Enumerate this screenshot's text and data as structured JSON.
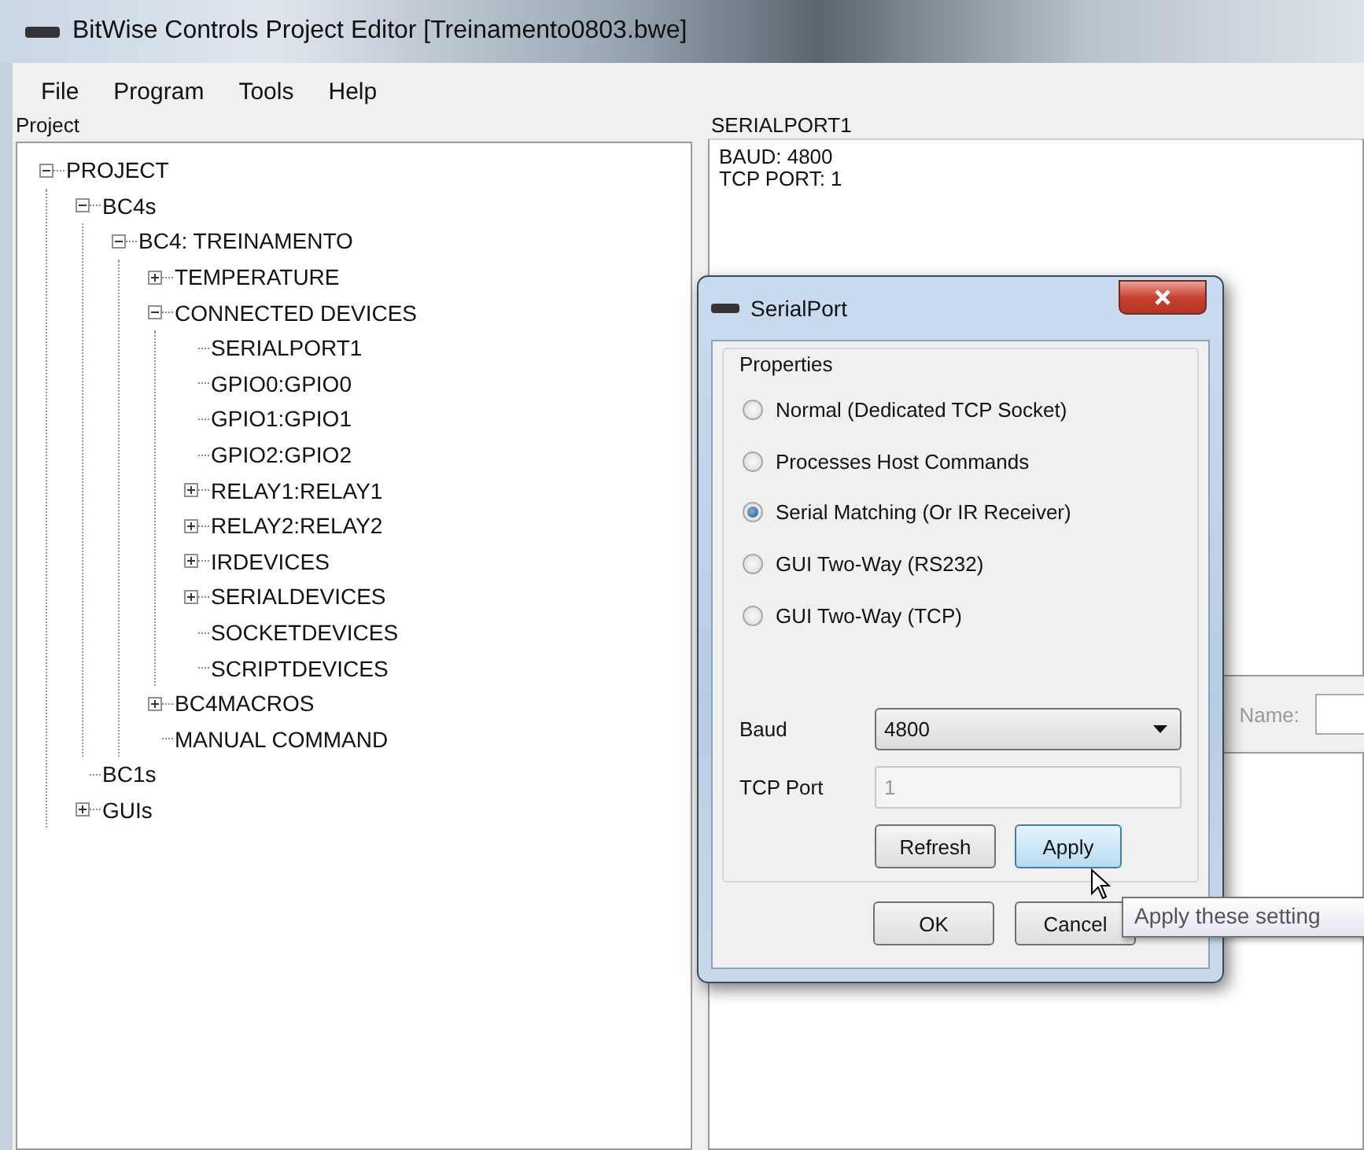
{
  "window": {
    "title": "BitWise Controls Project Editor [Treinamento0803.bwe]"
  },
  "menu": [
    "File",
    "Program",
    "Tools",
    "Help"
  ],
  "project_panel": {
    "title": "Project",
    "tree": [
      {
        "label": "PROJECT",
        "kind": "branch",
        "expanded": true,
        "children": [
          {
            "label": "BC4s",
            "kind": "branch",
            "expanded": true,
            "children": [
              {
                "label": "BC4: TREINAMENTO",
                "kind": "branch",
                "expanded": true,
                "children": [
                  {
                    "label": "TEMPERATURE",
                    "kind": "branch",
                    "expanded": false
                  },
                  {
                    "label": "CONNECTED DEVICES",
                    "kind": "branch",
                    "expanded": true,
                    "children": [
                      {
                        "label": "SERIALPORT1",
                        "kind": "leaf"
                      },
                      {
                        "label": "GPIO0:GPIO0",
                        "kind": "leaf"
                      },
                      {
                        "label": "GPIO1:GPIO1",
                        "kind": "leaf"
                      },
                      {
                        "label": "GPIO2:GPIO2",
                        "kind": "leaf"
                      },
                      {
                        "label": "RELAY1:RELAY1",
                        "kind": "branch",
                        "expanded": false
                      },
                      {
                        "label": "RELAY2:RELAY2",
                        "kind": "branch",
                        "expanded": false
                      },
                      {
                        "label": "IRDEVICES",
                        "kind": "branch",
                        "expanded": false
                      },
                      {
                        "label": "SERIALDEVICES",
                        "kind": "branch",
                        "expanded": false
                      },
                      {
                        "label": "SOCKETDEVICES",
                        "kind": "leaf"
                      },
                      {
                        "label": "SCRIPTDEVICES",
                        "kind": "leaf"
                      }
                    ]
                  },
                  {
                    "label": "BC4MACROS",
                    "kind": "branch",
                    "expanded": false
                  },
                  {
                    "label": "MANUAL COMMAND",
                    "kind": "leaf"
                  }
                ]
              }
            ]
          },
          {
            "label": "BC1s",
            "kind": "leaf"
          },
          {
            "label": "GUIs",
            "kind": "branch",
            "expanded": false
          }
        ]
      }
    ]
  },
  "detail_panel": {
    "title": "SERIALPORT1",
    "lines": [
      "BAUD: 4800",
      "TCP PORT: 1"
    ]
  },
  "lower_panel": {
    "name_label": "Name:"
  },
  "dialog": {
    "title": "SerialPort",
    "group_title": "Properties",
    "options": [
      {
        "label": "Normal (Dedicated TCP Socket)",
        "selected": false
      },
      {
        "label": "Processes Host Commands",
        "selected": false
      },
      {
        "label": "Serial Matching (Or IR Receiver)",
        "selected": true
      },
      {
        "label": "GUI Two-Way (RS232)",
        "selected": false
      },
      {
        "label": "GUI Two-Way (TCP)",
        "selected": false
      }
    ],
    "baud": {
      "label": "Baud",
      "value": "4800"
    },
    "tcp_port": {
      "label": "TCP Port",
      "value": "1",
      "disabled": true
    },
    "buttons": [
      {
        "label": "Refresh",
        "hovered": false
      },
      {
        "label": "Apply",
        "hovered": true
      }
    ],
    "footer_buttons": [
      "OK",
      "Cancel"
    ]
  },
  "tooltip": {
    "text": "Apply these setting"
  }
}
